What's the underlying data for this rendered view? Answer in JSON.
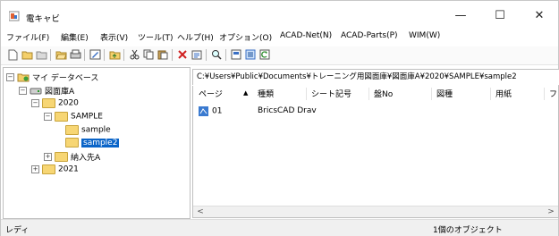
{
  "window": {
    "title": "電キャビ",
    "minimize": "—",
    "maximize": "☐",
    "close": "✕"
  },
  "menu": [
    "ファイル(F)",
    "編集(E)",
    "表示(V)",
    "ツール(T)",
    "ヘルプ(H)",
    "オプション(O)",
    "ACAD-Net(N)",
    "ACAD-Parts(P)",
    "WIM(W)"
  ],
  "toolbar": {
    "icons": [
      "new-icon",
      "open-icon",
      "folder-icon",
      "folder-open-icon",
      "print-icon",
      "edit-icon",
      "up-folder-icon",
      "cut-icon",
      "copy-icon",
      "paste-icon",
      "delete-icon",
      "properties-icon",
      "search-icon",
      "view-large-icon",
      "view-details-icon",
      "refresh-icon"
    ]
  },
  "tree": {
    "root": "マイ データベース",
    "library": "図面庫A",
    "year1": "2020",
    "folder1": "SAMPLE",
    "sub1": "sample",
    "sub2": "sample2",
    "folder2": "納入先A",
    "year2": "2021"
  },
  "path": "C:¥Users¥Public¥Documents¥トレーニング用図面庫¥図面庫A¥2020¥SAMPLE¥sample2",
  "list": {
    "columns": [
      "ページ",
      "種類",
      "シート記号",
      "盤No",
      "図種",
      "用紙",
      "フ"
    ],
    "sort_indicator": "▲",
    "rows": [
      {
        "page": "01",
        "type": "BricsCAD Drav"
      }
    ]
  },
  "status": {
    "left": "レディ",
    "right": "1個のオブジェクト"
  }
}
